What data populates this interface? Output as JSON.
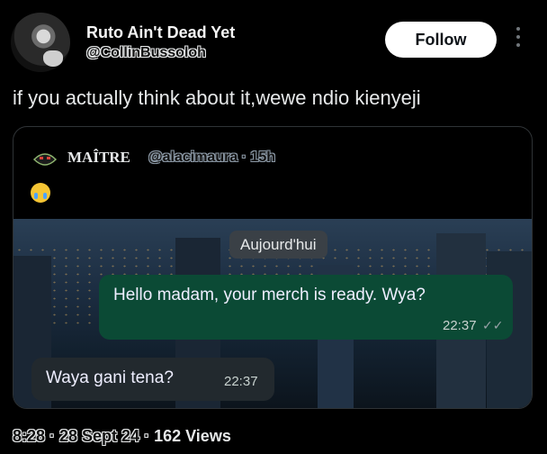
{
  "author": {
    "name": "Ruto Ain't Dead Yet",
    "handle": "@CollinBussoloh"
  },
  "follow_label": "Follow",
  "tweet_text": "if you actually think about it,wewe ndio kienyeji",
  "quote": {
    "name": "MAÎTRE",
    "meta": "@alacimaura · 15h",
    "emoji": "crying-face-emoji",
    "chat": {
      "date_pill": "Aujourd'hui",
      "outgoing": {
        "text": "Hello madam, your merch is ready. Wya?",
        "time": "22:37",
        "ticks": "✓✓"
      },
      "incoming": {
        "text": "Waya gani tena?",
        "time": "22:37"
      }
    }
  },
  "footer": {
    "time_date": "8:28 · 28 Sept 24 · ",
    "views_count": "162",
    "views_label": " Views"
  }
}
